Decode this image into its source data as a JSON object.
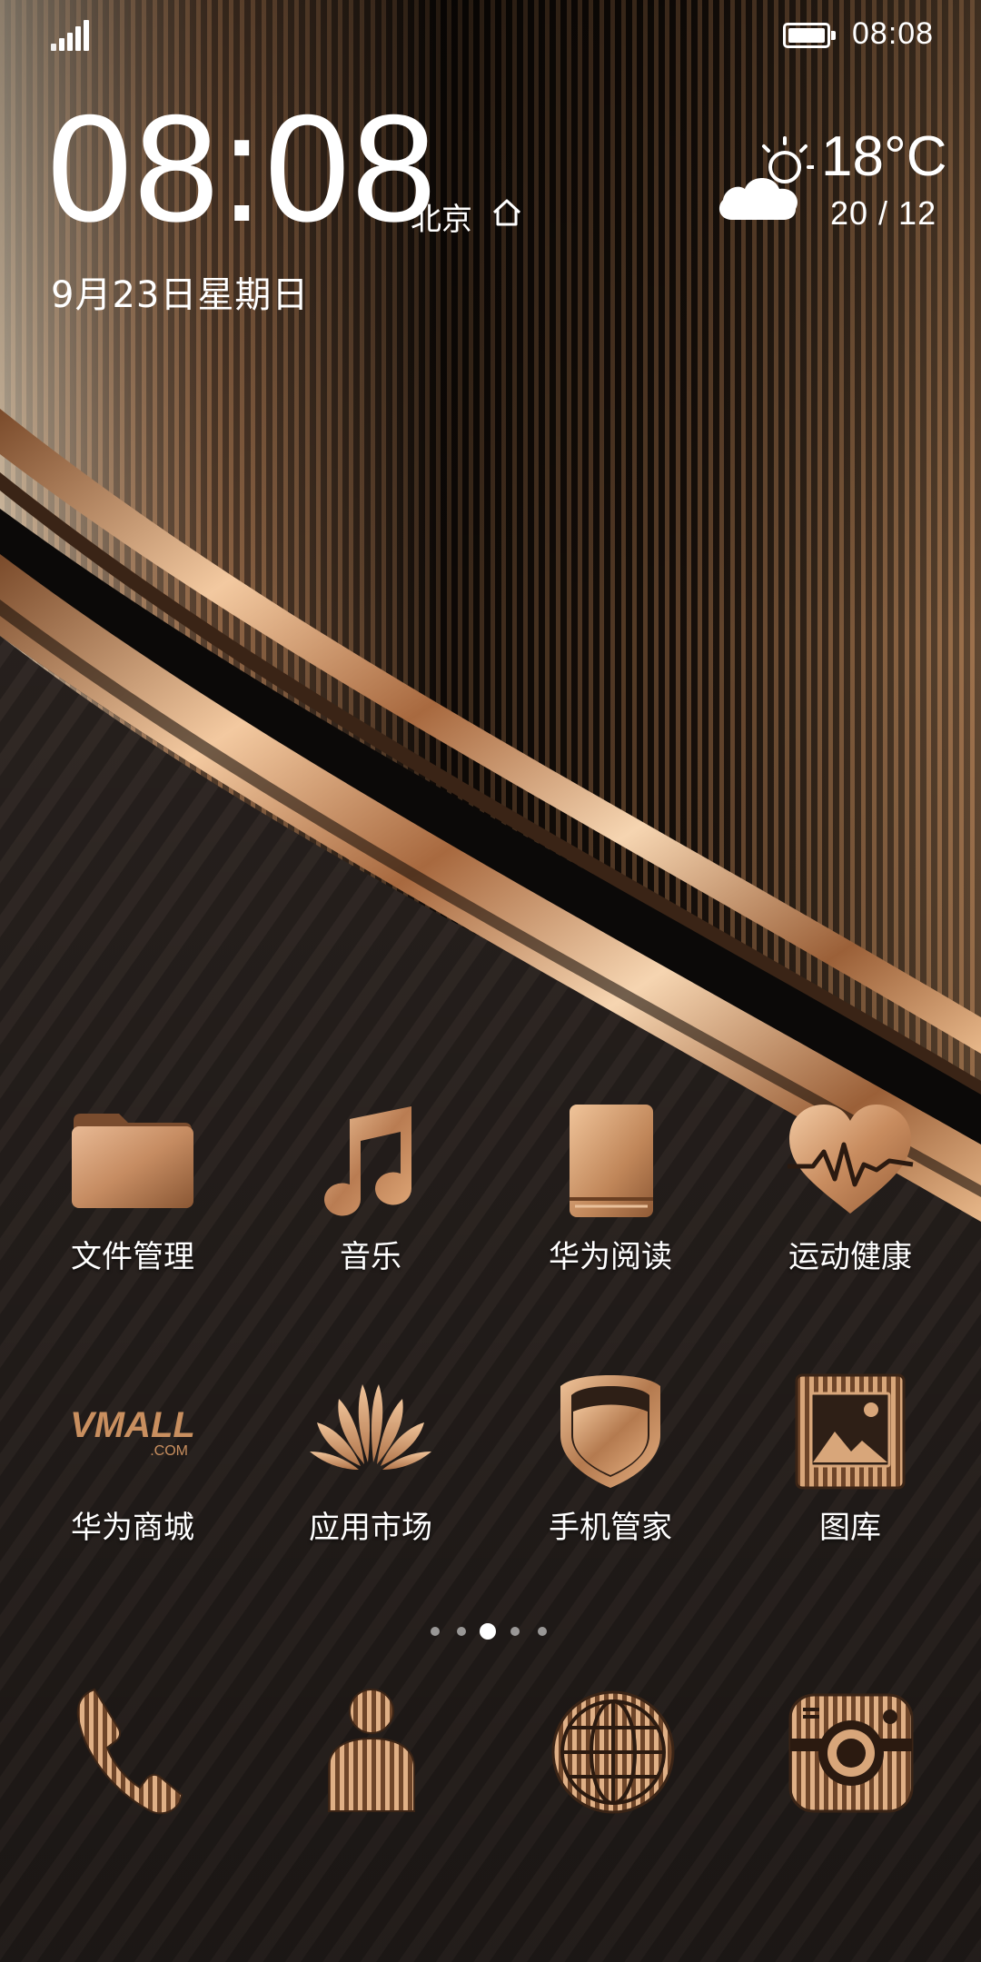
{
  "status_bar": {
    "time": "08:08",
    "signal_icon": "signal-bars-icon",
    "battery_icon": "battery-full-icon"
  },
  "clock_widget": {
    "time": "08:08",
    "city": "北京",
    "date": "9月23日星期日",
    "home_icon": "home-icon"
  },
  "weather": {
    "icon": "partly-cloudy-icon",
    "temperature": "18°C",
    "range": "20 / 12"
  },
  "apps": [
    {
      "label": "文件管理",
      "icon": "folder-icon"
    },
    {
      "label": "音乐",
      "icon": "music-note-icon"
    },
    {
      "label": "华为阅读",
      "icon": "book-icon"
    },
    {
      "label": "运动健康",
      "icon": "heart-pulse-icon"
    },
    {
      "label": "华为商城",
      "icon": "vmall-logo-icon",
      "logo_text": "VMALL",
      "logo_sub": ".COM"
    },
    {
      "label": "应用市场",
      "icon": "huawei-logo-icon"
    },
    {
      "label": "手机管家",
      "icon": "shield-icon"
    },
    {
      "label": "图库",
      "icon": "gallery-icon"
    }
  ],
  "page_indicator": {
    "pages": 5,
    "current": 3
  },
  "dock": [
    {
      "icon": "phone-icon"
    },
    {
      "icon": "contacts-icon"
    },
    {
      "icon": "browser-globe-icon"
    },
    {
      "icon": "camera-icon"
    }
  ],
  "colors": {
    "accent_gold": "#c98f5f",
    "gold_light": "#f0c49a",
    "background_dark": "#1a1614"
  }
}
